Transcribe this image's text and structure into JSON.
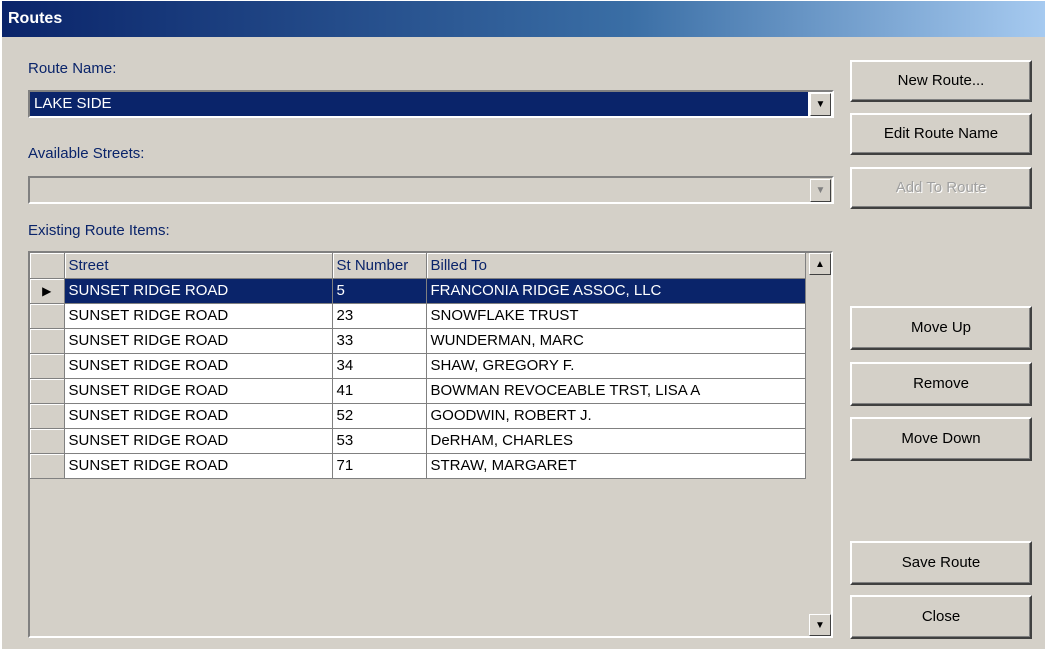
{
  "window": {
    "title": "Routes"
  },
  "route_name": {
    "label": "Route Name:",
    "value": "LAKE SIDE"
  },
  "available_streets": {
    "label": "Available Streets:",
    "value": ""
  },
  "existing_items": {
    "label": "Existing Route Items:"
  },
  "grid": {
    "columns": [
      "Street",
      "St Number",
      "Billed To"
    ],
    "rows": [
      {
        "street": "SUNSET RIDGE ROAD",
        "number": "5",
        "billed_to": "FRANCONIA RIDGE ASSOC, LLC"
      },
      {
        "street": "SUNSET RIDGE ROAD",
        "number": "23",
        "billed_to": "SNOWFLAKE TRUST"
      },
      {
        "street": "SUNSET RIDGE ROAD",
        "number": "33",
        "billed_to": "WUNDERMAN, MARC"
      },
      {
        "street": "SUNSET RIDGE ROAD",
        "number": "34",
        "billed_to": "SHAW, GREGORY F."
      },
      {
        "street": "SUNSET RIDGE ROAD",
        "number": "41",
        "billed_to": "BOWMAN REVOCEABLE TRST, LISA A"
      },
      {
        "street": "SUNSET RIDGE ROAD",
        "number": "52",
        "billed_to": "GOODWIN, ROBERT J."
      },
      {
        "street": "SUNSET RIDGE ROAD",
        "number": "53",
        "billed_to": "DeRHAM, CHARLES"
      },
      {
        "street": "SUNSET RIDGE ROAD",
        "number": "71",
        "billed_to": "STRAW, MARGARET"
      }
    ],
    "selected_row": 0
  },
  "buttons": {
    "new_route": "New Route...",
    "edit_route_name": "Edit Route Name",
    "add_to_route": "Add To Route",
    "move_up": "Move Up",
    "remove": "Remove",
    "move_down": "Move Down",
    "save_route": "Save Route",
    "close": "Close"
  },
  "icons": {
    "row_pointer": "row-pointer-icon",
    "dropdown_arrow": "chevron-down-icon",
    "scroll_up": "scroll-up-icon",
    "scroll_down": "scroll-down-icon"
  },
  "colors": {
    "selection": "#0a246a",
    "face": "#d4d0c8"
  }
}
